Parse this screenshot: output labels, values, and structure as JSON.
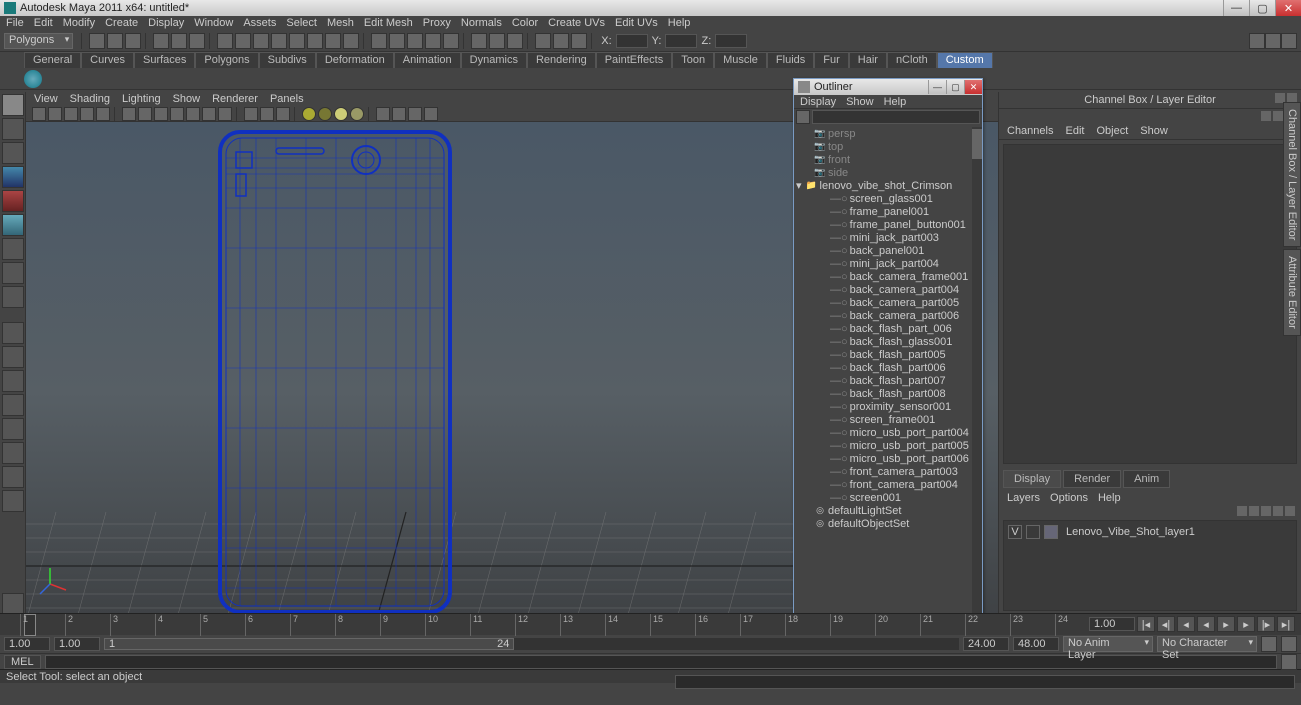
{
  "title": "Autodesk Maya 2011 x64: untitled*",
  "menubar": [
    "File",
    "Edit",
    "Modify",
    "Create",
    "Display",
    "Window",
    "Assets",
    "Select",
    "Mesh",
    "Edit Mesh",
    "Proxy",
    "Normals",
    "Color",
    "Create UVs",
    "Edit UVs",
    "Help"
  ],
  "module_dropdown": "Polygons",
  "coord_labels": {
    "x": "X:",
    "y": "Y:",
    "z": "Z:"
  },
  "shelf_tabs": [
    "General",
    "Curves",
    "Surfaces",
    "Polygons",
    "Subdivs",
    "Deformation",
    "Animation",
    "Dynamics",
    "Rendering",
    "PaintEffects",
    "Toon",
    "Muscle",
    "Fluids",
    "Fur",
    "Hair",
    "nCloth",
    "Custom"
  ],
  "shelf_active_index": 16,
  "viewport_menus": [
    "View",
    "Shading",
    "Lighting",
    "Show",
    "Renderer",
    "Panels"
  ],
  "right_side_tabs": [
    "Channel Box / Layer Editor",
    "Attribute Editor"
  ],
  "channel_box": {
    "title": "Channel Box / Layer Editor",
    "tabs": [
      "Channels",
      "Edit",
      "Object",
      "Show"
    ],
    "layer_tabs": [
      "Display",
      "Render",
      "Anim"
    ],
    "layer_active_index": 0,
    "layer_menubar": [
      "Layers",
      "Options",
      "Help"
    ],
    "layers": [
      {
        "vis": "V",
        "name": "Lenovo_Vibe_Shot_layer1"
      }
    ]
  },
  "outliner": {
    "title": "Outliner",
    "menubar": [
      "Display",
      "Show",
      "Help"
    ],
    "items": [
      {
        "type": "cam",
        "name": "persp",
        "dim": true
      },
      {
        "type": "cam",
        "name": "top",
        "dim": true
      },
      {
        "type": "cam",
        "name": "front",
        "dim": true
      },
      {
        "type": "cam",
        "name": "side",
        "dim": true
      },
      {
        "type": "group",
        "name": "lenovo_vibe_shot_Crimson",
        "expanded": true
      },
      {
        "type": "mesh",
        "name": "screen_glass001",
        "child": true
      },
      {
        "type": "mesh",
        "name": "frame_panel001",
        "child": true
      },
      {
        "type": "mesh",
        "name": "frame_panel_button001",
        "child": true
      },
      {
        "type": "mesh",
        "name": "mini_jack_part003",
        "child": true
      },
      {
        "type": "mesh",
        "name": "back_panel001",
        "child": true
      },
      {
        "type": "mesh",
        "name": "mini_jack_part004",
        "child": true
      },
      {
        "type": "mesh",
        "name": "back_camera_frame001",
        "child": true
      },
      {
        "type": "mesh",
        "name": "back_camera_part004",
        "child": true
      },
      {
        "type": "mesh",
        "name": "back_camera_part005",
        "child": true
      },
      {
        "type": "mesh",
        "name": "back_camera_part006",
        "child": true
      },
      {
        "type": "mesh",
        "name": "back_flash_part_006",
        "child": true
      },
      {
        "type": "mesh",
        "name": "back_flash_glass001",
        "child": true
      },
      {
        "type": "mesh",
        "name": "back_flash_part005",
        "child": true
      },
      {
        "type": "mesh",
        "name": "back_flash_part006",
        "child": true
      },
      {
        "type": "mesh",
        "name": "back_flash_part007",
        "child": true
      },
      {
        "type": "mesh",
        "name": "back_flash_part008",
        "child": true
      },
      {
        "type": "mesh",
        "name": "proximity_sensor001",
        "child": true
      },
      {
        "type": "mesh",
        "name": "screen_frame001",
        "child": true
      },
      {
        "type": "mesh",
        "name": "micro_usb_port_part004",
        "child": true
      },
      {
        "type": "mesh",
        "name": "micro_usb_port_part005",
        "child": true
      },
      {
        "type": "mesh",
        "name": "micro_usb_port_part006",
        "child": true
      },
      {
        "type": "mesh",
        "name": "front_camera_part003",
        "child": true
      },
      {
        "type": "mesh",
        "name": "front_camera_part004",
        "child": true
      },
      {
        "type": "mesh",
        "name": "screen001",
        "child": true
      },
      {
        "type": "set",
        "name": "defaultLightSet"
      },
      {
        "type": "set",
        "name": "defaultObjectSet"
      }
    ]
  },
  "timeline": {
    "start_field": "1.00",
    "range_start": "1.00",
    "range_label_left": "1",
    "range_label_right": "24",
    "range_end": "24.00",
    "end_field": "48.00",
    "current": "1.00",
    "ticks": [
      1,
      2,
      3,
      4,
      5,
      6,
      7,
      8,
      9,
      10,
      11,
      12,
      13,
      14,
      15,
      16,
      17,
      18,
      19,
      20,
      21,
      22,
      23,
      24
    ],
    "anim_layer": "No Anim Layer",
    "char_set": "No Character Set"
  },
  "mel_label": "MEL",
  "status_text": "Select Tool: select an object"
}
